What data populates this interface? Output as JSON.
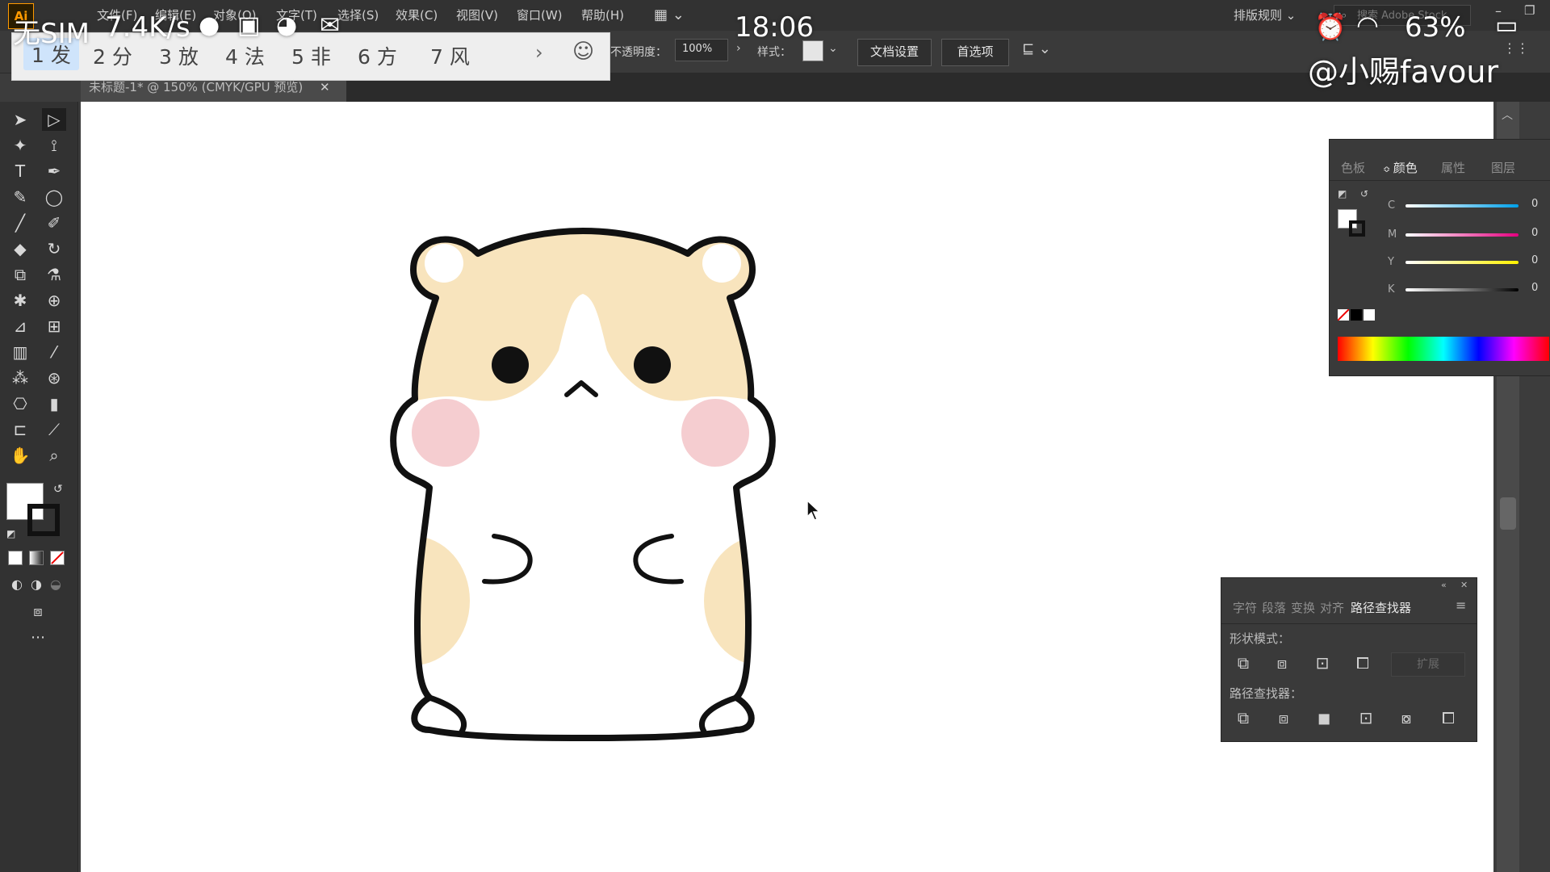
{
  "status": {
    "carrier": "无SIM",
    "net_speed": "7.4K/s",
    "time": "18:06",
    "battery": "63%",
    "watermark": "@小赐favour"
  },
  "app": {
    "logo_letter": "Ai"
  },
  "menu": {
    "items": [
      "文件(F)",
      "编辑(E)",
      "对象(O)",
      "文字(T)",
      "选择(S)",
      "效果(C)",
      "视图(V)",
      "窗口(W)",
      "帮助(H)"
    ],
    "workspace": "排版规则",
    "search_placeholder": "搜索 Adobe Stock"
  },
  "control": {
    "opacity_label": "不透明度：",
    "opacity_value": "100%",
    "style_label": "样式：",
    "doc_settings": "文档设置",
    "preferences": "首选项"
  },
  "ime": {
    "candidates": [
      "1 发",
      "2 分",
      "3 放",
      "4 法",
      "5 非",
      "6 方",
      "7 风"
    ]
  },
  "document": {
    "tab_title": "未标题-1* @ 150% (CMYK/GPU 预览)"
  },
  "color_panel": {
    "tabs": [
      "色板",
      "颜色",
      "属性",
      "图层"
    ],
    "active_tab": "颜色",
    "sliders": [
      {
        "label": "C",
        "value": "0"
      },
      {
        "label": "M",
        "value": "0"
      },
      {
        "label": "Y",
        "value": "0"
      },
      {
        "label": "K",
        "value": "0"
      }
    ]
  },
  "pathfinder_panel": {
    "tabs": [
      "字符",
      "段落",
      "变换",
      "对齐",
      "路径查找器"
    ],
    "active_tab": "路径查找器",
    "shape_modes_label": "形状模式：",
    "expand_label": "扩展",
    "pathfinders_label": "路径查找器："
  },
  "colors": {
    "hamster_fill": "#f8e4bd",
    "cheek": "#f5cdd0",
    "outline": "#111111",
    "ui_dark": "#323232"
  }
}
